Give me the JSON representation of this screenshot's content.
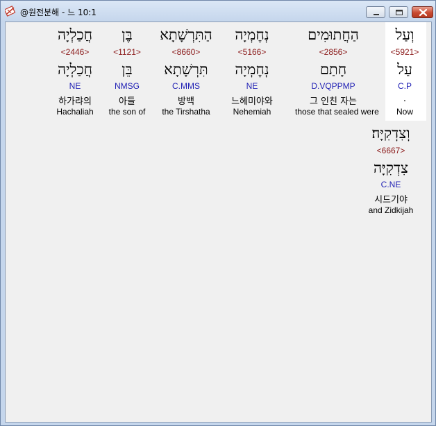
{
  "window": {
    "title": "@원전분해 - 느 10:1"
  },
  "words": [
    {
      "hebrew": "וְעַל",
      "strong": "<5921>",
      "lemma": "עַל",
      "morph": "C.P",
      "korean": ".",
      "english": "Now"
    },
    {
      "hebrew": "הַחֲתוּמִים",
      "strong": "<2856>",
      "lemma": "חָתַם",
      "morph": "D.VQPPMP",
      "korean": "그 인친 자는",
      "english": "those that sealed were"
    },
    {
      "hebrew": "נְחֶמְיָה",
      "strong": "<5166>",
      "lemma": "נְחֶמְיָה",
      "morph": "NE",
      "korean": "느헤미야와",
      "english": "Nehemiah"
    },
    {
      "hebrew": "הַתִּרְשָׁתָא",
      "strong": "<8660>",
      "lemma": "תִּרְשָׁתָא",
      "morph": "C.MMS",
      "korean": "방백",
      "english": "the Tirshatha"
    },
    {
      "hebrew": "בֶּן",
      "strong": "<1121>",
      "lemma": "בֵּן",
      "morph": "NMSG",
      "korean": "아들",
      "english": "the son of"
    },
    {
      "hebrew": "חֲכַלְיָה",
      "strong": "<2446>",
      "lemma": "חֲכַלְיָה",
      "morph": "NE",
      "korean": "하가랴의",
      "english": "Hachaliah"
    },
    {
      "hebrew": "וְצִדְקִיָּה׃",
      "strong": "<6667>",
      "lemma": "צִדְקִיָּה",
      "morph": "C.NE",
      "korean": "시드기야",
      "english": "and Zidkijah"
    }
  ],
  "icons": {
    "app": "app-logo-icon",
    "minimize": "minimize-icon",
    "maximize": "maximize-icon",
    "close": "close-icon"
  },
  "colors": {
    "strong": "#8b1a1a",
    "morph": "#1f1fb4",
    "highlight": "#ffffff",
    "client_bg": "#f0f0f0"
  }
}
